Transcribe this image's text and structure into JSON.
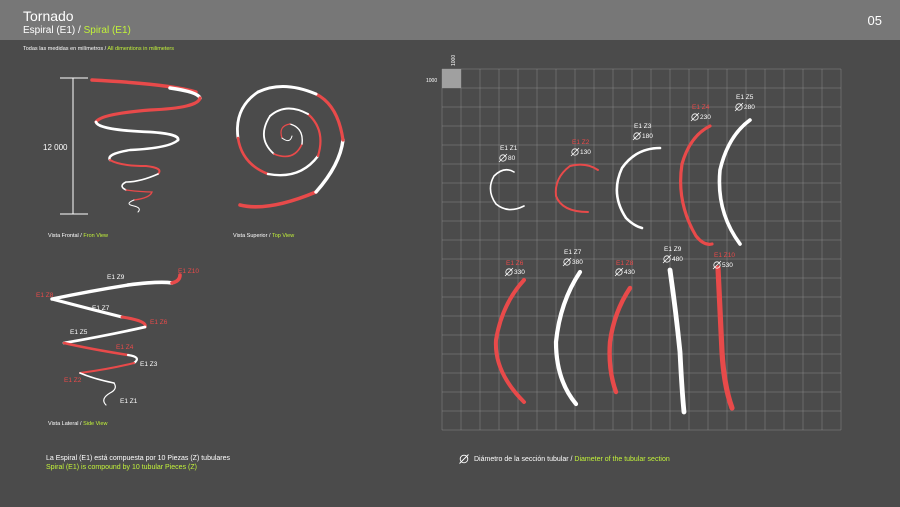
{
  "header": {
    "title": "Tornado",
    "subtitle_es": "Espiral (E1)",
    "subtitle_sep": " / ",
    "subtitle_en": "Spiral (E1)",
    "page_number": "05"
  },
  "note": {
    "es": "Todas las medidas en milímetros",
    "sep": " / ",
    "en": "All dimentions in milimeters"
  },
  "front_view": {
    "dimension": "12 000",
    "caption_es": "Vista Frontal",
    "caption_en": "Fron View"
  },
  "top_view": {
    "caption_es": "Vista Superior",
    "caption_en": "Top View"
  },
  "side_view": {
    "caption_es": "Vista Lateral",
    "caption_en": "Side View",
    "labels": [
      "E1 Z1",
      "E1 Z2",
      "E1 Z3",
      "E1 Z4",
      "E1 Z5",
      "E1 Z6",
      "E1 Z7",
      "E1 Z8",
      "E1 Z9",
      "E1 Z10"
    ]
  },
  "grid": {
    "scale_label": "1000",
    "scale_label_vertical": "1000",
    "pieces": [
      {
        "id": "E1 Z1",
        "diameter": "80",
        "color": "#ffffff"
      },
      {
        "id": "E1 Z2",
        "diameter": "130",
        "color": "#e84a4a"
      },
      {
        "id": "E1 Z3",
        "diameter": "180",
        "color": "#ffffff"
      },
      {
        "id": "E1 Z4",
        "diameter": "230",
        "color": "#e84a4a"
      },
      {
        "id": "E1 Z5",
        "diameter": "280",
        "color": "#ffffff"
      },
      {
        "id": "E1 Z6",
        "diameter": "330",
        "color": "#e84a4a"
      },
      {
        "id": "E1 Z7",
        "diameter": "380",
        "color": "#ffffff"
      },
      {
        "id": "E1 Z8",
        "diameter": "430",
        "color": "#e84a4a"
      },
      {
        "id": "E1 Z9",
        "diameter": "480",
        "color": "#ffffff"
      },
      {
        "id": "E1 Z10",
        "diameter": "530",
        "color": "#e84a4a"
      }
    ]
  },
  "footer": {
    "composition_es": "La Espiral (E1) está compuesta por 10 Piezas (Z) tubulares",
    "composition_en": "Spiral (E1) is compound by 10 tubular Pieces (Z)",
    "legend_es": "Diámetro de la sección tubular",
    "legend_sep": " / ",
    "legend_en": "Diameter of the tubular section"
  },
  "colors": {
    "background": "#4b4b4b",
    "header": "#777777",
    "red": "#e84a4a",
    "white": "#ffffff",
    "lime": "#c2f23a",
    "grid": "#8a8a8a"
  }
}
